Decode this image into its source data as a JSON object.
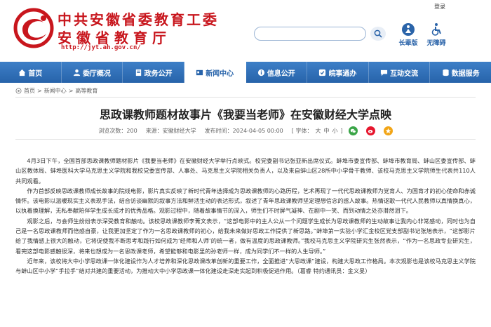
{
  "header": {
    "title_main": "中共安徽省委教育工委",
    "title_sub": "安徽省教育厅",
    "url": "http://jyt.ah.gov.cn/",
    "login": "登录",
    "search_placeholder": "",
    "accessibility": [
      {
        "label": "长辈版",
        "icon": "elder-icon"
      },
      {
        "label": "无障碍",
        "icon": "wheelchair-icon"
      }
    ],
    "brand_color": "#c8161d",
    "nav_color": "#2763aa"
  },
  "nav": [
    {
      "label": "首页",
      "icon": "home-icon",
      "active": false
    },
    {
      "label": "委厅概况",
      "icon": "people-icon",
      "active": false
    },
    {
      "label": "政务公开",
      "icon": "document-icon",
      "active": false
    },
    {
      "label": "新闻中心",
      "icon": "news-icon",
      "active": true
    },
    {
      "label": "信息公开",
      "icon": "info-icon",
      "active": false
    },
    {
      "label": "皖事通办",
      "icon": "service-icon",
      "active": false
    },
    {
      "label": "互动交流",
      "icon": "chat-icon",
      "active": false
    },
    {
      "label": "数据服务",
      "icon": "data-icon",
      "active": false
    }
  ],
  "breadcrumb": [
    "首页",
    "新闻中心",
    "高等教育"
  ],
  "article": {
    "title": "思政课教师题材故事片《我要当老师》在安徽财经大学点映",
    "views": "浏览次数：200",
    "source": "来源：安徽财经大学",
    "time": "发布时间：2024-04-05 00:00",
    "font_label": "[ 字体：",
    "font_sizes": [
      "大",
      "中",
      "小"
    ],
    "font_end": "]",
    "paragraphs": [
      "4月3日下午，全国首部思政课教师题材影片《我要当老师》在安徽财经大学举行点映式。校党委副书记张亚新出席仪式。蚌埠市委宣传部、蚌埠市教育局、蚌山区委宣传部、蚌山区教体局、蚌埠医科大学马克思主义学院和我校党委宣传部、人事处、马克思主义学院相关负责人，以及来自蚌山区28所中小学骨干教师、该校马克思主义学院师生代表共110人共同观看。",
      "作为首部反映思政课教师成长故事的院线电影，影片真实反映了新时代青年选择成为思政课教师的心路历程，艺术再现了一代代思政课教师为党育人、为国育才的初心使命和赤诚情怀。该电影以温暖现实主义表现手法，结合访谈幽默的叙事方法和鲜活生动的表达形式，叙述了青年思政课教师坚定理想信念的感人故事。热情讴歌一代代人民教师以真情换真心，以执着换理解，无私奉献陪伴学生成长成才的优秀品格。观影过程中，随着故事情节的深入，师生们不时屏气凝神、在剧中一笑、而到动情之处亦潸然泪下。",
      "观影之后，与会师生纷纷表示深受教育和触动。该校思政课教师李菁文表示，“这部电影中的主人公从一个问题学生成长为思政课教师的生动故事让我内心非常感动，同时也为自己是一名思政课教师而倍感自豪，让我更加坚定了作为一名思政课教师的初心，给我未来做好思政工作提供了新思路。”蚌埠第一实验小学汇金校区党支部副书记张旭表示，“这部影片给了我情感上很大的触动，它将促使我不断思考和践行如何成为‘经师和人师’的统一者，做有温度的思政课教师。”我校马克思主义学院研究生张然表示，“作为一名思政专业研究生，看完这部电影感触很深，将来也想成为一名思政课老师，希望能够和电影里的孙老师一样，成为同学们不一样的人生导师。”",
      "近年来，该校将大中小学思政课一体化建设作为人才培养和深化思政课改革创新的重要工作，全面推进“大思政课”建设，构建大思政工作格局。本次观影也是该校马克思主义学院与蚌山区中小学“手拉手”结对共建的重要活动，为推动大中小学思政课一体化建设走深走实起到积极促进作用。（葛睿 特约通讯员：金义旻）"
    ]
  }
}
